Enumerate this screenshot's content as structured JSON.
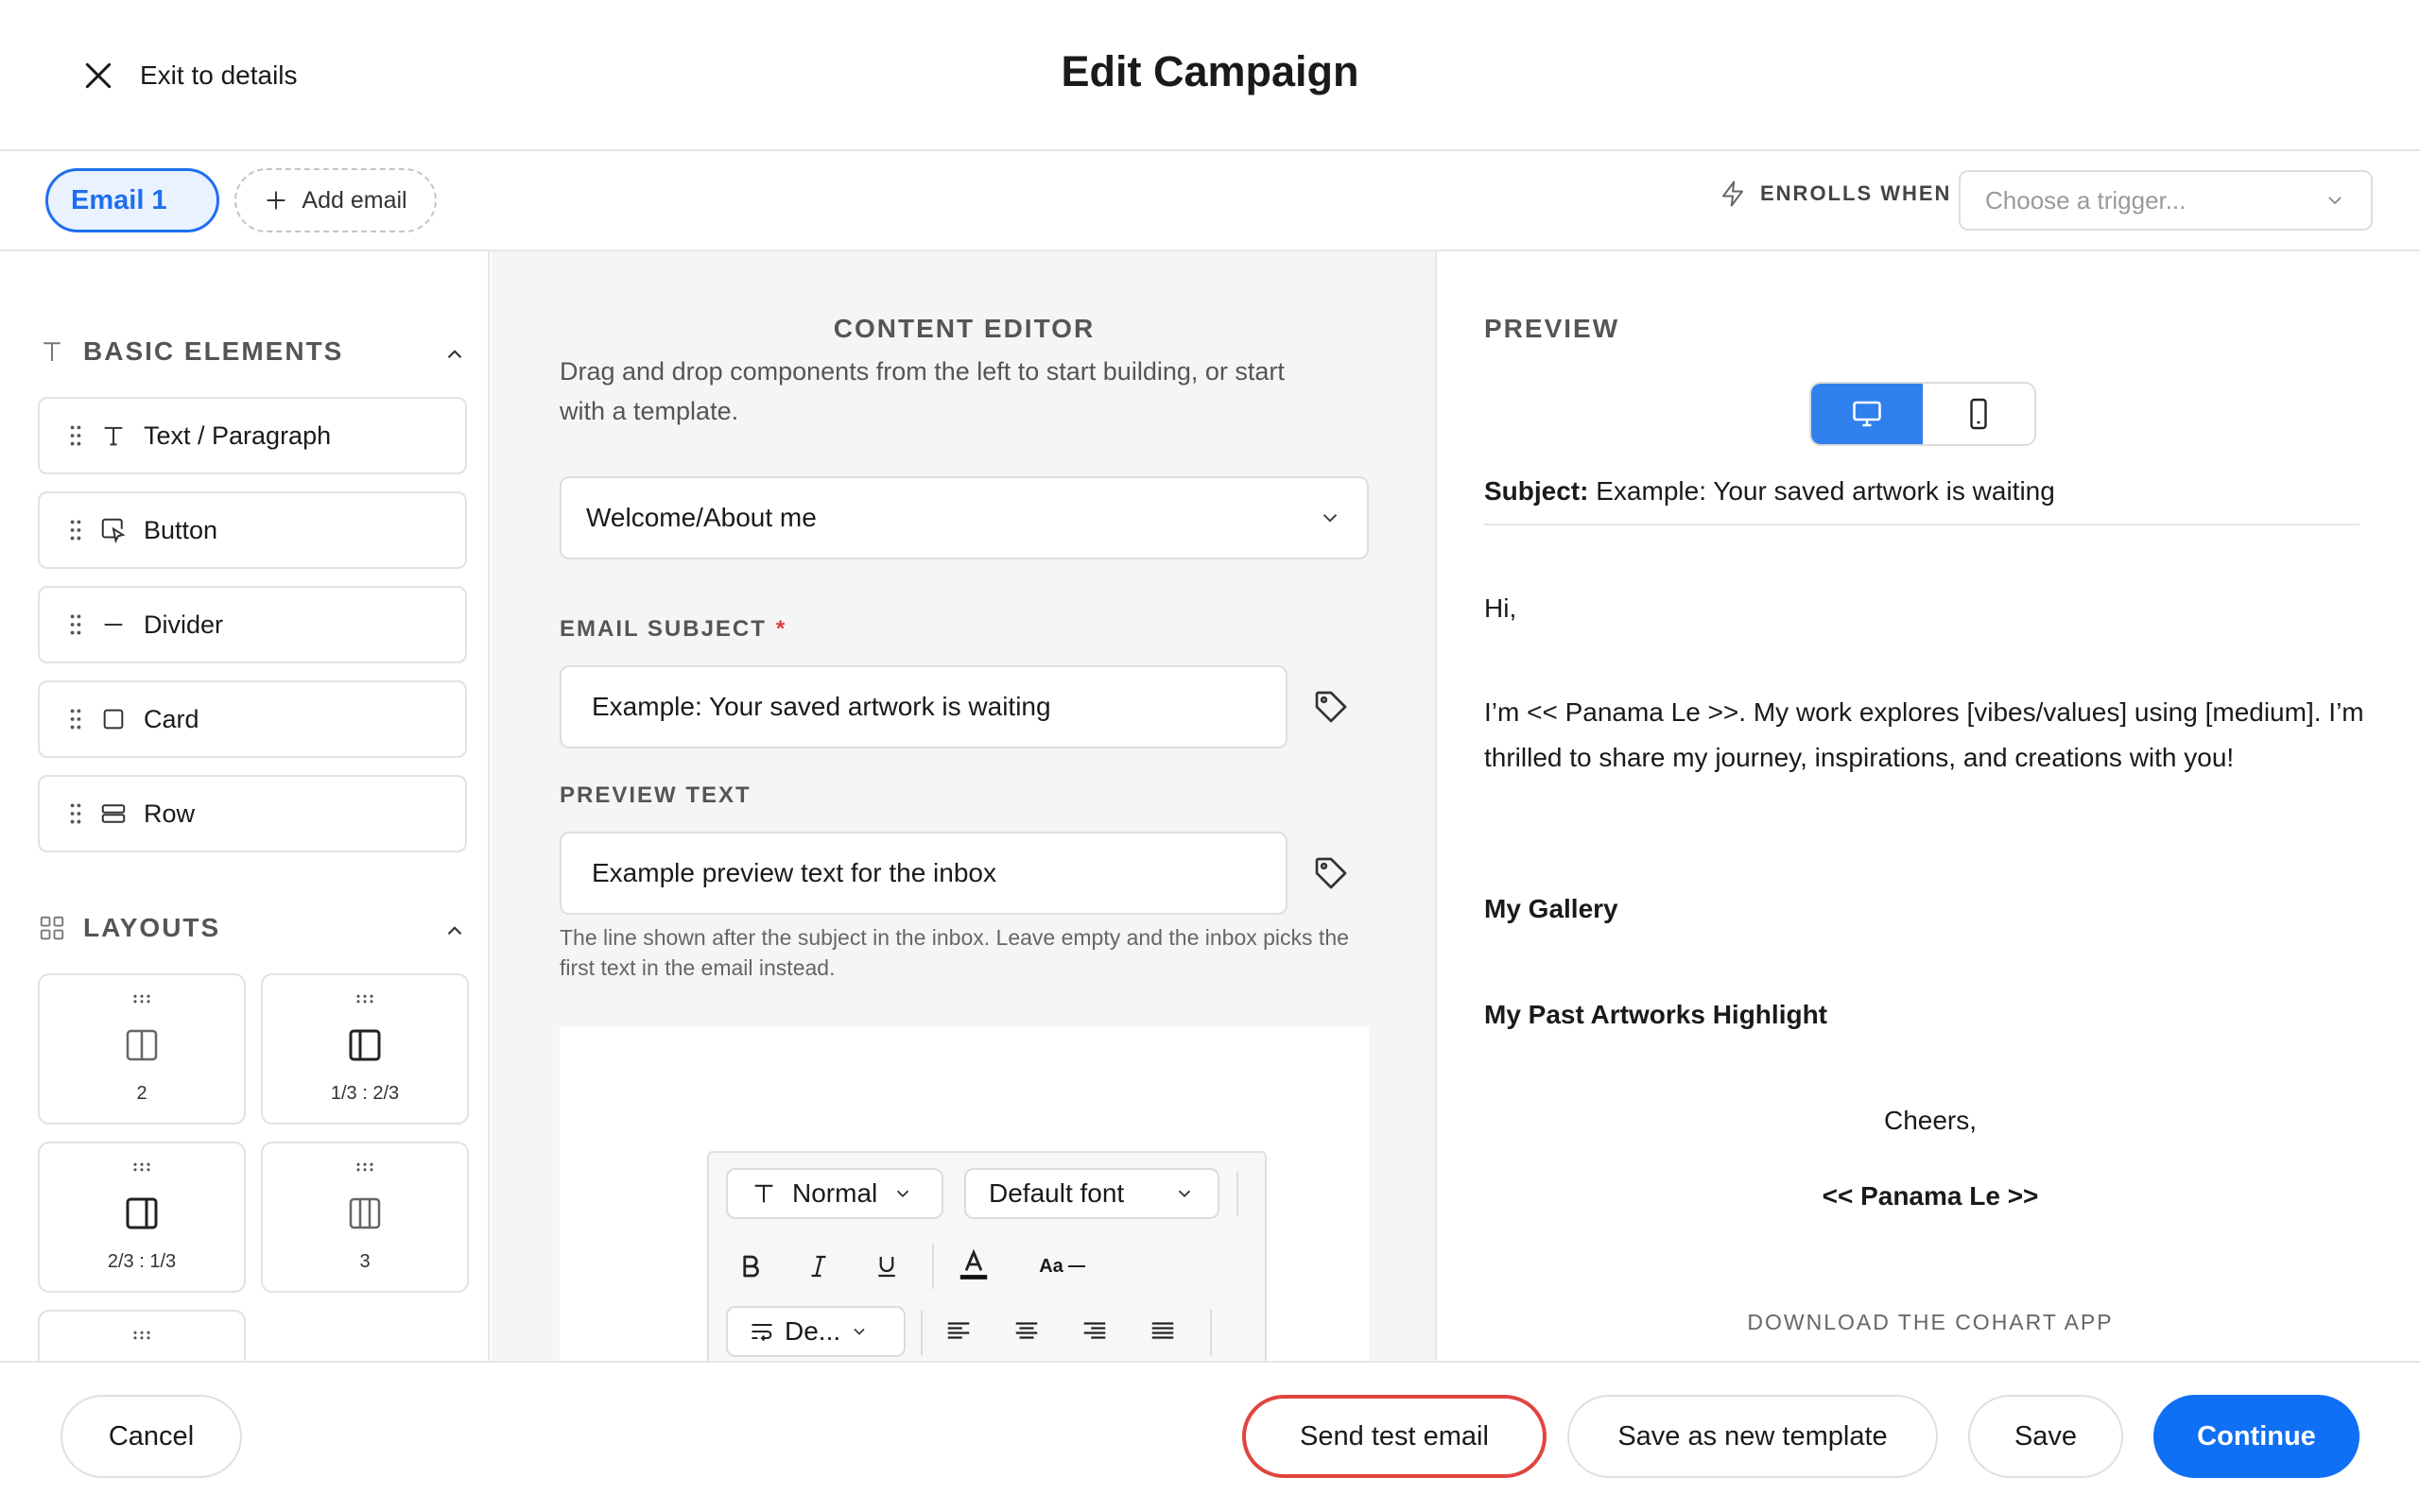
{
  "header": {
    "exit_label": "Exit to details",
    "title": "Edit Campaign"
  },
  "tabs": {
    "email_tab": "Email 1",
    "add_email": "Add email",
    "enrolls_label": "ENROLLS WHEN",
    "trigger_placeholder": "Choose a trigger..."
  },
  "left": {
    "basic_heading": "BASIC ELEMENTS",
    "elements": [
      {
        "label": "Text / Paragraph",
        "icon": "text-icon"
      },
      {
        "label": "Button",
        "icon": "button-cursor-icon"
      },
      {
        "label": "Divider",
        "icon": "divider-icon"
      },
      {
        "label": "Card",
        "icon": "card-icon"
      },
      {
        "label": "Row",
        "icon": "row-icon"
      }
    ],
    "layouts_heading": "LAYOUTS",
    "layouts": [
      {
        "label": "2"
      },
      {
        "label": "1/3 : 2/3"
      },
      {
        "label": "2/3 : 1/3"
      },
      {
        "label": "3"
      }
    ]
  },
  "editor": {
    "title": "CONTENT EDITOR",
    "description": "Drag and drop components from the left to start building, or start with a template.",
    "template_value": "Welcome/About me",
    "subject_label": "EMAIL SUBJECT",
    "subject_required": "*",
    "subject_value": "Example: Your saved artwork is waiting",
    "preview_label": "PREVIEW TEXT",
    "preview_value": "Example preview text for the inbox",
    "preview_help": "The line shown after the subject in the inbox. Leave empty and the inbox picks the first text in the email instead.",
    "toolbar": {
      "style": "Normal",
      "font": "Default font",
      "aa_label": "Aa",
      "line_height": "De..."
    }
  },
  "preview": {
    "title": "PREVIEW",
    "subject_label": "Subject:",
    "subject_value": "Example: Your saved artwork is waiting",
    "greeting": "Hi,",
    "intro": "I’m << Panama Le >>. My work explores [vibes/values] using [medium]. I’m thrilled to share my journey, inspirations, and creations with you!",
    "gallery": "My Gallery",
    "highlight": "My Past Artworks Highlight",
    "cheers": "Cheers,",
    "signature": "<< Panama Le >>",
    "download": "DOWNLOAD THE COHART APP"
  },
  "footer": {
    "cancel": "Cancel",
    "send_test": "Send test email",
    "save_template": "Save as new template",
    "save": "Save",
    "continue": "Continue"
  },
  "colors": {
    "accent": "#0f6ff5",
    "highlight_ring": "#e0453f",
    "required": "#e23b3b"
  }
}
